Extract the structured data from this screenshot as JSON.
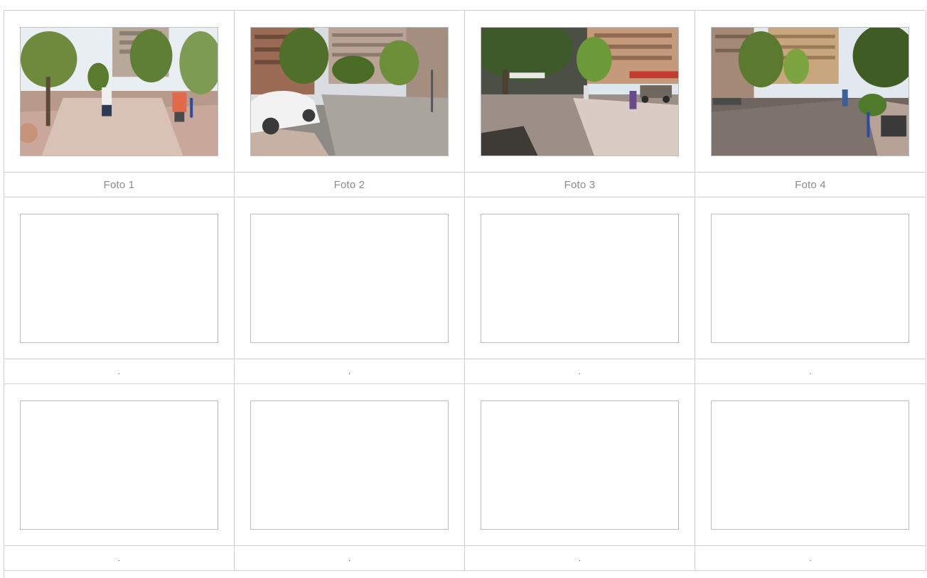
{
  "rows": [
    {
      "photos": [
        {
          "name": "photo-1",
          "state": "filled",
          "scene": "street-with-trees-and-pedestrians"
        },
        {
          "name": "photo-2",
          "state": "filled",
          "scene": "street-with-white-car"
        },
        {
          "name": "photo-3",
          "state": "filled",
          "scene": "sunny-street-with-tree-and-runner"
        },
        {
          "name": "photo-4",
          "state": "filled",
          "scene": "cobblestone-street-with-bench"
        }
      ],
      "captions": [
        "Foto 1",
        "Foto 2",
        "Foto 3",
        "Foto 4"
      ]
    },
    {
      "photos": [
        {
          "name": "photo-5",
          "state": "empty"
        },
        {
          "name": "photo-6",
          "state": "empty"
        },
        {
          "name": "photo-7",
          "state": "empty"
        },
        {
          "name": "photo-8",
          "state": "empty"
        }
      ],
      "captions": [
        ".",
        ".",
        ".",
        "."
      ]
    },
    {
      "photos": [
        {
          "name": "photo-9",
          "state": "empty"
        },
        {
          "name": "photo-10",
          "state": "empty"
        },
        {
          "name": "photo-11",
          "state": "empty"
        },
        {
          "name": "photo-12",
          "state": "empty"
        }
      ],
      "captions": [
        ".",
        ".",
        ".",
        "."
      ]
    }
  ],
  "colors": {
    "grid_line": "#cfcfcf",
    "frame_border": "#bdbdbd",
    "caption_text": "#8a8a8a"
  }
}
